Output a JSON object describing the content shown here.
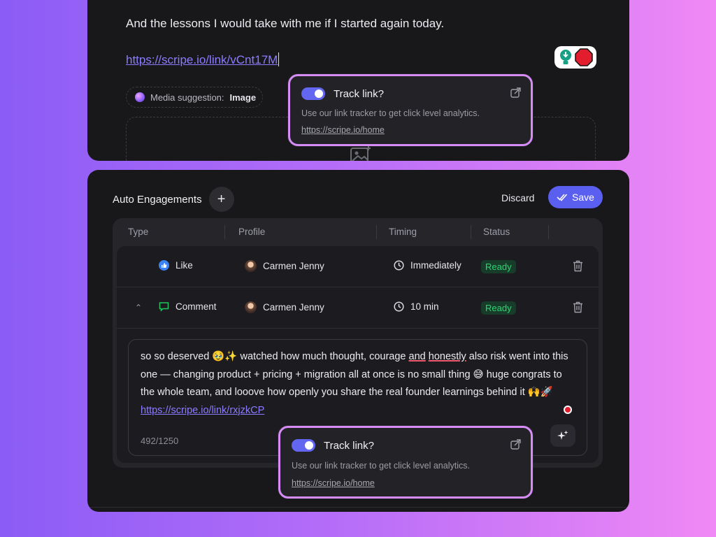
{
  "post": {
    "text_line": "And the lessons I would take with me if I started again today.",
    "link": "https://scripe.io/link/vCnt17M",
    "media_suggestion_label": "Media suggestion:",
    "media_suggestion_value": "Image"
  },
  "track_link": {
    "title": "Track link?",
    "description": "Use our link tracker to get click level analytics.",
    "url": "https://scripe.io/home",
    "enabled": true
  },
  "engagements": {
    "title": "Auto Engagements",
    "add_label": "+",
    "discard_label": "Discard",
    "save_label": "Save",
    "columns": [
      "Type",
      "Profile",
      "Timing",
      "Status"
    ],
    "rows": [
      {
        "type": "Like",
        "profile": "Carmen Jenny",
        "timing": "Immediately",
        "status": "Ready"
      },
      {
        "type": "Comment",
        "profile": "Carmen Jenny",
        "timing": "10 min",
        "status": "Ready"
      }
    ],
    "comment": {
      "part1": "so so deserved 🥹✨ watched how much thought, courage ",
      "spell1": "and",
      "space": " ",
      "spell2": "honestly",
      "part2": " also risk went into this one — changing product + pricing + migration all at once is no small thing 😅 huge congrats to the whole team, and looove how openly you share the real founder learnings behind it 🙌🚀 ",
      "link": "https://scripe.io/link/rxjzkCP",
      "counter": "492/1250"
    }
  },
  "colors": {
    "accent": "#5b5ff0",
    "link": "#8b7cff",
    "ready": "#2ed573",
    "highlight_border": "#d58cf5"
  }
}
